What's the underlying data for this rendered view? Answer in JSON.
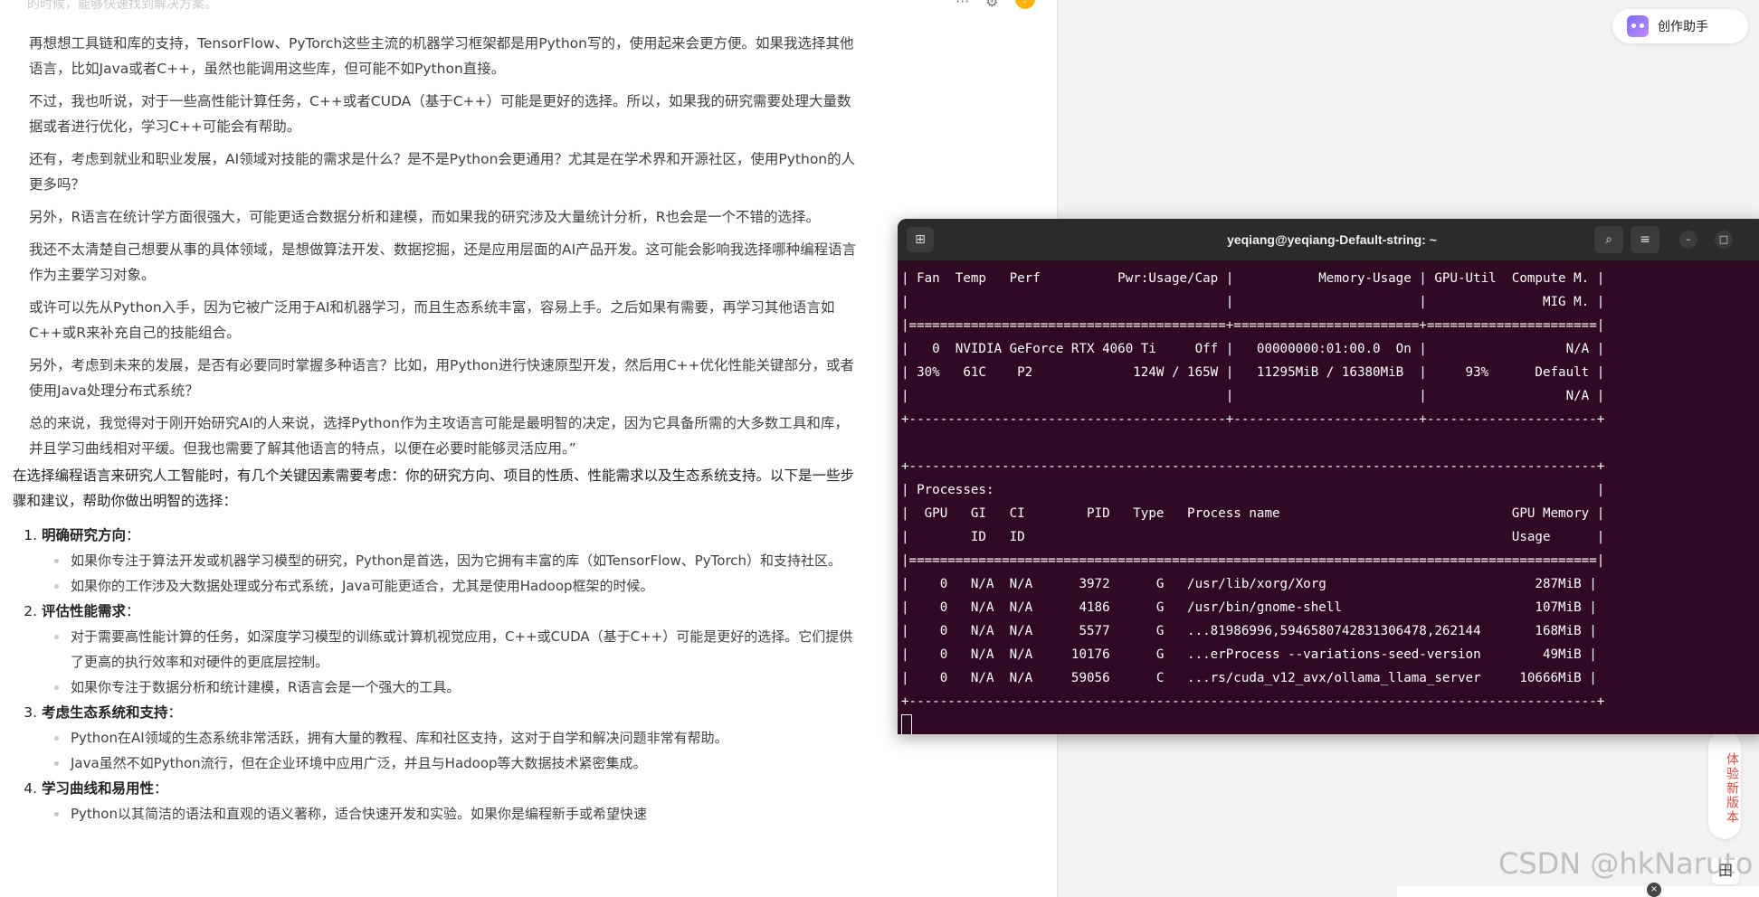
{
  "article": {
    "top_fade": "的时候，能够快速找到解决方案。",
    "tools": {
      "more": "···",
      "settings": "⚙",
      "badge": "!"
    },
    "quote_paragraphs": [
      "再想想工具链和库的支持，TensorFlow、PyTorch这些主流的机器学习框架都是用Python写的，使用起来会更方便。如果我选择其他语言，比如Java或者C++，虽然也能调用这些库，但可能不如Python直接。",
      "不过，我也听说，对于一些高性能计算任务，C++或者CUDA（基于C++）可能是更好的选择。所以，如果我的研究需要处理大量数据或者进行优化，学习C++可能会有帮助。",
      "还有，考虑到就业和职业发展，AI领域对技能的需求是什么？是不是Python会更通用？尤其是在学术界和开源社区，使用Python的人更多吗？",
      "另外，R语言在统计学方面很强大，可能更适合数据分析和建模，而如果我的研究涉及大量统计分析，R也会是一个不错的选择。",
      "我还不太清楚自己想要从事的具体领域，是想做算法开发、数据挖掘，还是应用层面的AI产品开发。这可能会影响我选择哪种编程语言作为主要学习对象。",
      "或许可以先从Python入手，因为它被广泛用于AI和机器学习，而且生态系统丰富，容易上手。之后如果有需要，再学习其他语言如C++或R来补充自己的技能组合。",
      "另外，考虑到未来的发展，是否有必要同时掌握多种语言？比如，用Python进行快速原型开发，然后用C++优化性能关键部分，或者使用Java处理分布式系统？",
      "总的来说，我觉得对于刚开始研究AI的人来说，选择Python作为主攻语言可能是最明智的决定，因为它具备所需的大多数工具和库，并且学习曲线相对平缓。但我也需要了解其他语言的特点，以便在必要时能够灵活应用。”"
    ],
    "intro": "在选择编程语言来研究人工智能时，有几个关键因素需要考虑：你的研究方向、项目的性质、性能需求以及生态系统支持。以下是一些步骤和建议，帮助你做出明智的选择：",
    "sections": [
      {
        "head": "明确研究方向",
        "colon": "：",
        "bullets": [
          "如果你专注于算法开发或机器学习模型的研究，Python是首选，因为它拥有丰富的库（如TensorFlow、PyTorch）和支持社区。",
          "如果你的工作涉及大数据处理或分布式系统，Java可能更适合，尤其是使用Hadoop框架的时候。"
        ]
      },
      {
        "head": "评估性能需求",
        "colon": "：",
        "bullets": [
          "对于需要高性能计算的任务，如深度学习模型的训练或计算机视觉应用，C++或CUDA（基于C++）可能是更好的选择。它们提供了更高的执行效率和对硬件的更底层控制。",
          "如果你专注于数据分析和统计建模，R语言会是一个强大的工具。"
        ]
      },
      {
        "head": "考虑生态系统和支持",
        "colon": "：",
        "bullets": [
          "Python在AI领域的生态系统非常活跃，拥有大量的教程、库和社区支持，这对于自学和解决问题非常有帮助。",
          "Java虽然不如Python流行，但在企业环境中应用广泛，并且与Hadoop等大数据技术紧密集成。"
        ]
      },
      {
        "head": "学习曲线和易用性",
        "colon": "：",
        "bullets": [
          "Python以其简洁的语法和直观的语义著称，适合快速开发和实验。如果你是编程新手或希望快速"
        ]
      }
    ]
  },
  "sidebar": {
    "creator_label": "创作助手",
    "try_new_label": "体验新版本",
    "grid_label": "田",
    "watermark": "CSDN @hkNaruto",
    "close_label": "×"
  },
  "terminal": {
    "title": "yeqiang@yeqiang-Default-string: ~",
    "newtab_icon": "⊞",
    "search_icon": "⌕",
    "menu_icon": "≡",
    "min_icon": "–",
    "max_icon": "□",
    "lines": [
      "| Fan  Temp   Perf          Pwr:Usage/Cap |           Memory-Usage | GPU-Util  Compute M. |",
      "|                                         |                        |               MIG M. |",
      "|=========================================+========================+======================|",
      "|   0  NVIDIA GeForce RTX 4060 Ti     Off |   00000000:01:00.0  On |                  N/A |",
      "| 30%   61C    P2             124W / 165W |   11295MiB / 16380MiB  |     93%      Default |",
      "|                                         |                        |                  N/A |",
      "+-----------------------------------------+------------------------+----------------------+",
      "",
      "+-----------------------------------------------------------------------------------------+",
      "| Processes:                                                                              |",
      "|  GPU   GI   CI        PID   Type   Process name                              GPU Memory |",
      "|        ID   ID                                                               Usage      |",
      "|=========================================================================================|",
      "|    0   N/A  N/A      3972      G   /usr/lib/xorg/Xorg                           287MiB |",
      "|    0   N/A  N/A      4186      G   /usr/bin/gnome-shell                         107MiB |",
      "|    0   N/A  N/A      5577      G   ...81986996,5946580742831306478,262144       168MiB |",
      "|    0   N/A  N/A     10176      G   ...erProcess --variations-seed-version        49MiB |",
      "|    0   N/A  N/A     59056      C   ...rs/cuda_v12_avx/ollama_llama_server     10666MiB |",
      "+-----------------------------------------------------------------------------------------+"
    ]
  }
}
